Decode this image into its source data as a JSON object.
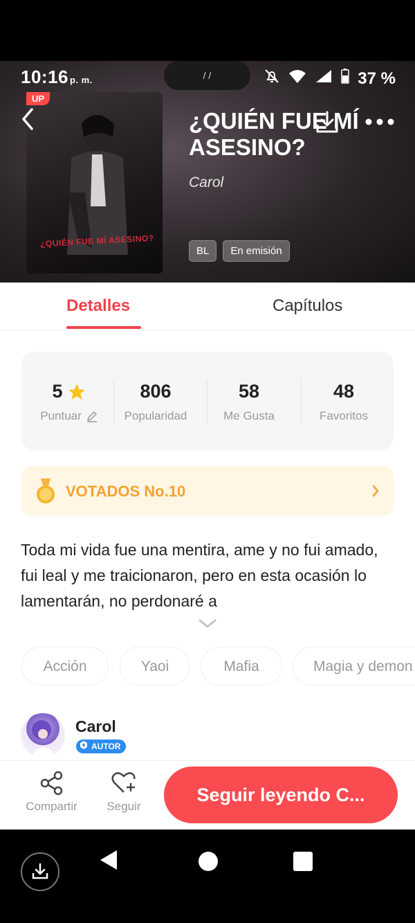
{
  "status_bar": {
    "time": "10:16",
    "ampm": "p. m.",
    "pill_text": "/ /",
    "battery": "37 %"
  },
  "book": {
    "badge": "UP",
    "title": "¿QUIÉN FUE MÍ ASESINO?",
    "author": "Carol",
    "cover_art_text": "¿QUIÉN FUE MÍ ASESINO?",
    "tags": [
      "BL",
      "En emisión"
    ]
  },
  "tabs": {
    "details": "Detalles",
    "chapters": "Capítulos"
  },
  "stats": [
    {
      "value": "5",
      "label": "Puntuar"
    },
    {
      "value": "806",
      "label": "Popularidad"
    },
    {
      "value": "58",
      "label": "Me Gusta"
    },
    {
      "value": "48",
      "label": "Favoritos"
    }
  ],
  "ranking": {
    "text": "VOTADOS No.10"
  },
  "description": "Toda mi vida fue una mentira, ame y  no fui amado, fui leal y me traicionaron, pero en esta ocasión lo lamentarán, no perdonaré a",
  "genres": [
    "Acción",
    "Yaoi",
    "Mafia",
    "Magia y demon"
  ],
  "author_block": {
    "name": "Carol",
    "badge": "AUTOR"
  },
  "actions": {
    "share": "Compartir",
    "follow": "Seguir",
    "read": "Seguir leyendo C..."
  },
  "colors": {
    "accent": "#f0424d",
    "read_button": "#f94b50",
    "ranking_text": "#f3a232",
    "author_badge": "#2d8cf0"
  }
}
